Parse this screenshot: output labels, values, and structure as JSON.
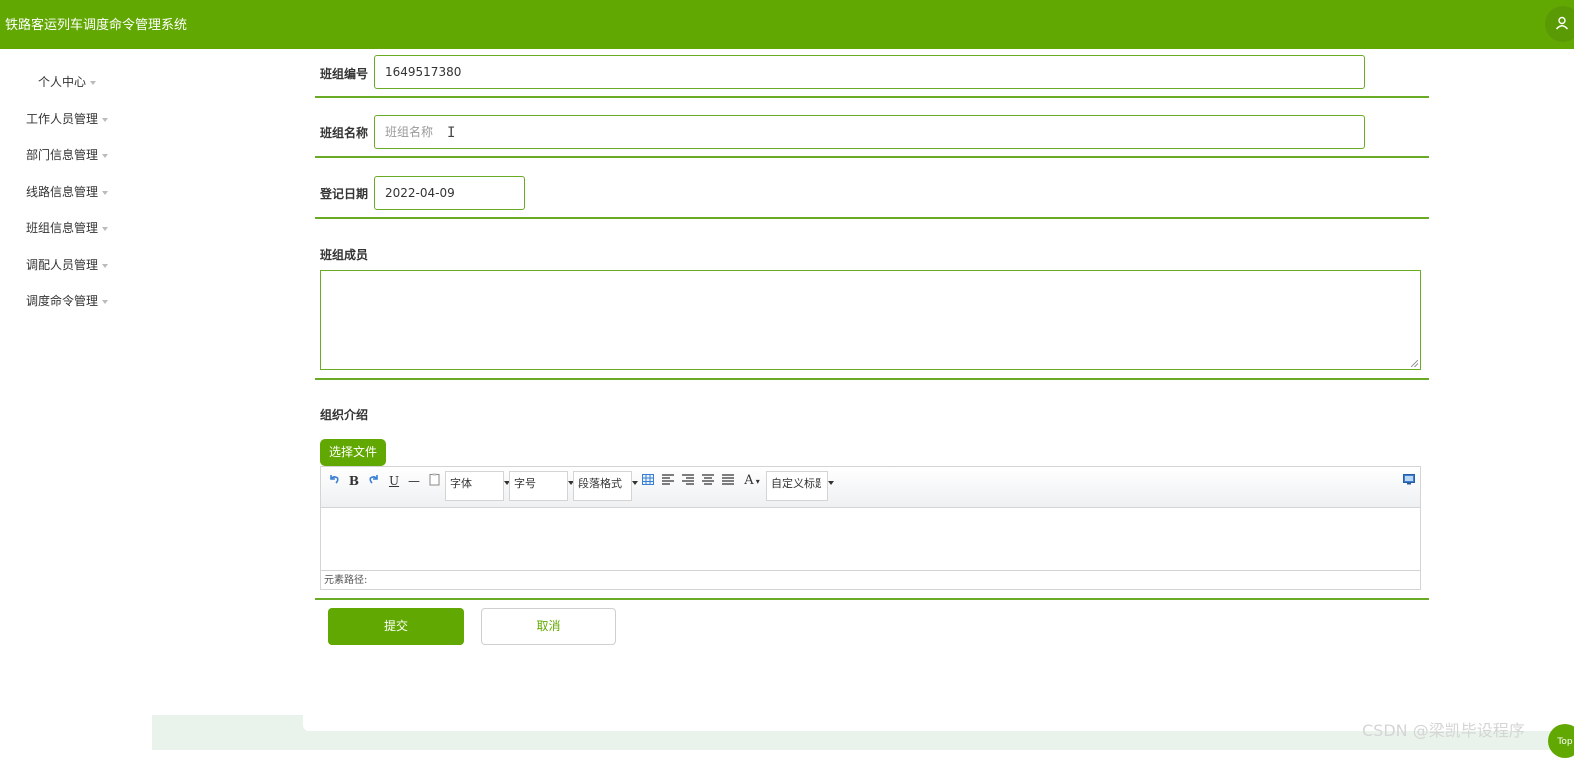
{
  "app": {
    "title": "铁路客运列车调度命令管理系统"
  },
  "sidebar": {
    "items": [
      {
        "label": "个人中心"
      },
      {
        "label": "工作人员管理"
      },
      {
        "label": "部门信息管理"
      },
      {
        "label": "线路信息管理"
      },
      {
        "label": "班组信息管理"
      },
      {
        "label": "调配人员管理"
      },
      {
        "label": "调度命令管理"
      }
    ]
  },
  "form": {
    "team_no": {
      "label": "班组编号",
      "value": "1649517380"
    },
    "team_name": {
      "label": "班组名称",
      "placeholder": "班组名称",
      "value": ""
    },
    "reg_date": {
      "label": "登记日期",
      "value": "2022-04-09"
    },
    "members": {
      "label": "班组成员",
      "value": ""
    },
    "intro": {
      "label": "组织介绍",
      "choose_file_label": "选择文件"
    }
  },
  "editor": {
    "toolbar": {
      "undo_icon": "undo-icon",
      "bold": "B",
      "redo_icon": "redo-icon",
      "underline": "U",
      "hr": "—",
      "paste_icon": "paste-icon",
      "font_family": "字体",
      "font_size": "字号",
      "paragraph": "段落格式",
      "table_icon": "table-icon",
      "font_color": "A",
      "custom_title": "自定义标题",
      "preview_icon": "preview-icon"
    },
    "status_path": "元素路径:"
  },
  "actions": {
    "submit": "提交",
    "cancel": "取消"
  },
  "watermark": "CSDN @梁凯毕设程序",
  "scroll_top": "Top",
  "colors": {
    "brand": "#62a802",
    "border": "#6aab25",
    "band": "#e9f3ec"
  }
}
